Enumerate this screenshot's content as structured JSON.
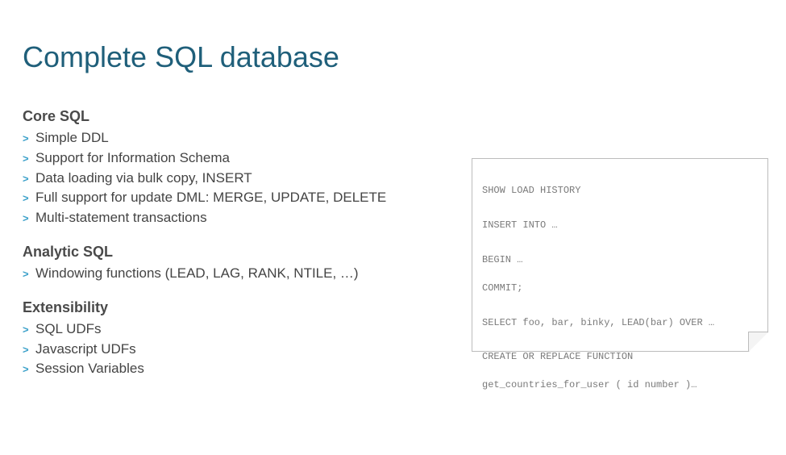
{
  "title": "Complete SQL database",
  "sections": [
    {
      "heading": "Core SQL",
      "items": [
        "Simple DDL",
        "Support for Information Schema",
        "Data loading via bulk copy, INSERT",
        "Full support for update DML:  MERGE, UPDATE, DELETE",
        "Multi-statement transactions"
      ]
    },
    {
      "heading": "Analytic SQL",
      "items": [
        "Windowing functions (LEAD, LAG, RANK, NTILE, …)"
      ]
    },
    {
      "heading": "Extensibility",
      "items": [
        "SQL UDFs",
        "Javascript UDFs",
        "Session Variables"
      ]
    }
  ],
  "code": {
    "l1": "SHOW LOAD HISTORY",
    "l2": "INSERT INTO …",
    "l3": "BEGIN …",
    "l4": "COMMIT;",
    "l5": "SELECT foo, bar, binky, LEAD(bar) OVER …",
    "l6": "CREATE OR REPLACE FUNCTION",
    "l7": "get_countries_for_user ( id number )…"
  }
}
